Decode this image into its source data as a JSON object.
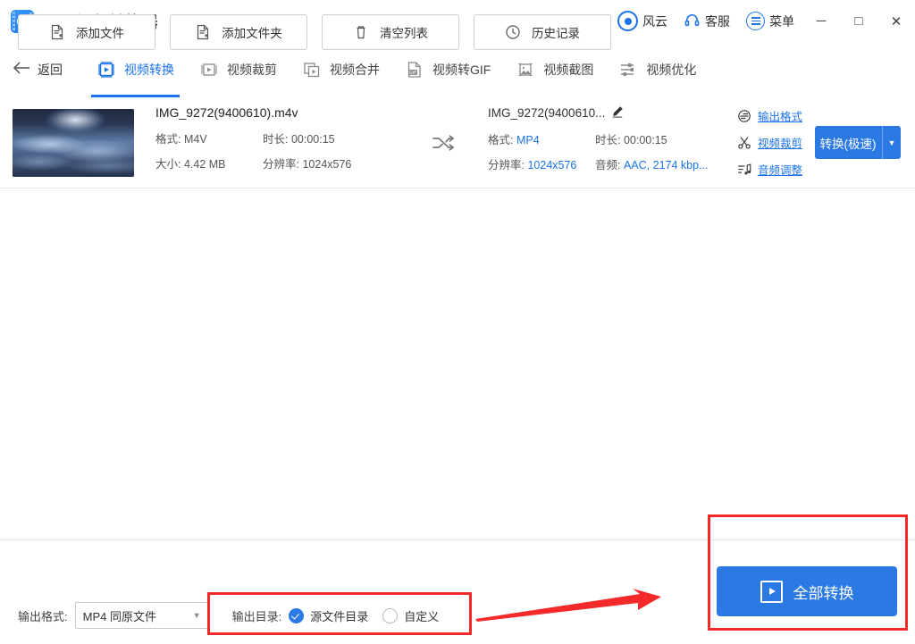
{
  "titlebar": {
    "app_name": "风云视频转换器",
    "logo_icon": "app-logo-icon",
    "account_label": "风云",
    "account_icon": "user-circle-icon",
    "support_label": "客服",
    "support_icon": "headset-icon",
    "menu_label": "菜单",
    "menu_icon": "list-menu-icon",
    "minimize_icon": "minimize-icon",
    "maximize_icon": "maximize-icon",
    "close_icon": "close-icon",
    "minimize_glyph": "─",
    "maximize_glyph": "□",
    "close_glyph": "✕"
  },
  "nav": {
    "back_label": "返回",
    "back_icon": "arrow-left-icon",
    "tabs": [
      {
        "label": "视频转换",
        "icon": "video-convert-icon",
        "active": true
      },
      {
        "label": "视频裁剪",
        "icon": "video-crop-icon",
        "active": false
      },
      {
        "label": "视频合并",
        "icon": "video-merge-icon",
        "active": false
      },
      {
        "label": "视频转GIF",
        "icon": "video-to-gif-icon",
        "active": false
      },
      {
        "label": "视频截图",
        "icon": "video-screenshot-icon",
        "active": false
      },
      {
        "label": "视频优化",
        "icon": "video-optimize-icon",
        "active": false
      }
    ]
  },
  "file_row": {
    "thumbnail_name": "video-thumbnail",
    "source": {
      "filename": "IMG_9272(9400610).m4v",
      "format_label": "格式:",
      "format_value": "M4V",
      "duration_label": "时长:",
      "duration_value": "00:00:15",
      "size_label": "大小:",
      "size_value": "4.42 MB",
      "resolution_label": "分辨率:",
      "resolution_value": "1024x576"
    },
    "swap_icon": "shuffle-arrows-icon",
    "output": {
      "filename": "IMG_9272(9400610...",
      "edit_icon": "pencil-edit-icon",
      "format_label": "格式:",
      "format_value": "MP4",
      "duration_label": "时长:",
      "duration_value": "00:00:15",
      "resolution_label": "分辨率:",
      "resolution_value": "1024x576",
      "audio_label": "音频:",
      "audio_value": "AAC, 2174 kbp..."
    },
    "actions": [
      {
        "label": "输出格式",
        "icon": "output-format-icon"
      },
      {
        "label": "视频裁剪",
        "icon": "scissors-icon"
      },
      {
        "label": "音频调整",
        "icon": "audio-note-icon"
      }
    ],
    "convert_button": {
      "label": "转换(极速)",
      "caret": "▼",
      "color": "#2b7ae4"
    }
  },
  "bottom": {
    "buttons": [
      {
        "label": "添加文件",
        "icon": "add-file-icon"
      },
      {
        "label": "添加文件夹",
        "icon": "add-folder-icon"
      },
      {
        "label": "清空列表",
        "icon": "trash-icon"
      },
      {
        "label": "历史记录",
        "icon": "history-clock-icon"
      }
    ],
    "output_format_label": "输出格式:",
    "output_format_value": "MP4 同原文件",
    "output_format_caret": "▼",
    "output_dir_label": "输出目录:",
    "radio_source": {
      "label": "源文件目录",
      "selected": true
    },
    "radio_custom": {
      "label": "自定义",
      "selected": false
    },
    "convert_all": {
      "label": "全部转换",
      "icon": "play-box-icon",
      "color": "#2b7ae4"
    }
  },
  "annotations": {
    "highlight_color": "#f42a2a",
    "box_output_dir": "output-directory-highlight",
    "box_convert_all": "convert-all-highlight",
    "arrow": "pointer-arrow"
  }
}
